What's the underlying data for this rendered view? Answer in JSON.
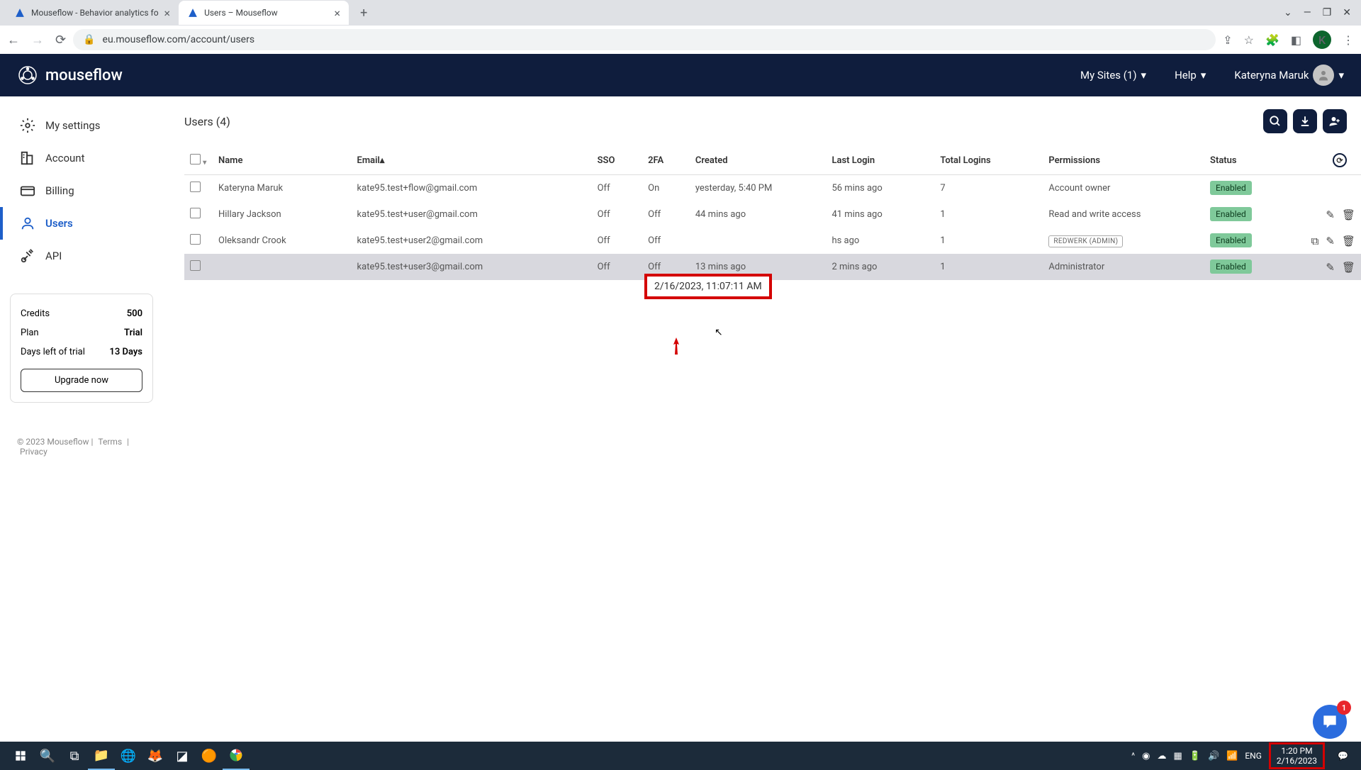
{
  "tabs": [
    {
      "title": "Mouseflow - Behavior analytics fo",
      "active": false
    },
    {
      "title": "Users – Mouseflow",
      "active": true
    }
  ],
  "url": "eu.mouseflow.com/account/users",
  "profile_initial": "K",
  "brand": "mouseflow",
  "header": {
    "my_sites": "My Sites (1)",
    "help": "Help",
    "user_name": "Kateryna Maruk"
  },
  "sidebar": {
    "items": [
      {
        "label": "My settings",
        "icon": "gear"
      },
      {
        "label": "Account",
        "icon": "building"
      },
      {
        "label": "Billing",
        "icon": "card"
      },
      {
        "label": "Users",
        "icon": "person",
        "active": true
      },
      {
        "label": "API",
        "icon": "plug"
      }
    ]
  },
  "credits": {
    "credits_label": "Credits",
    "credits_value": "500",
    "plan_label": "Plan",
    "plan_value": "Trial",
    "days_label": "Days left of trial",
    "days_value": "13 Days",
    "upgrade": "Upgrade now"
  },
  "footer": {
    "copyright": "© 2023 Mouseflow",
    "terms": "Terms",
    "privacy": "Privacy"
  },
  "page_title": "Users (4)",
  "table": {
    "headers": {
      "name": "Name",
      "email": "Email",
      "sso": "SSO",
      "twofa": "2FA",
      "created": "Created",
      "last_login": "Last Login",
      "total_logins": "Total Logins",
      "permissions": "Permissions",
      "status": "Status"
    },
    "rows": [
      {
        "name": "Kateryna Maruk",
        "email": "kate95.test+flow@gmail.com",
        "sso": "Off",
        "twofa": "On",
        "created": "yesterday, 5:40 PM",
        "last_login": "56 mins ago",
        "total_logins": "7",
        "permissions": "Account owner",
        "status": "Enabled",
        "actions": []
      },
      {
        "name": "Hillary Jackson",
        "email": "kate95.test+user@gmail.com",
        "sso": "Off",
        "twofa": "Off",
        "created": "44 mins ago",
        "last_login": "41 mins ago",
        "total_logins": "1",
        "permissions": "Read and write access",
        "status": "Enabled",
        "actions": [
          "edit",
          "delete"
        ]
      },
      {
        "name": "Oleksandr Crook",
        "email": "kate95.test+user2@gmail.com",
        "sso": "Off",
        "twofa": "Off",
        "created": "",
        "last_login": "hs ago",
        "total_logins": "1",
        "permissions_badge": "REDWERK (ADMIN)",
        "status": "Enabled",
        "actions": [
          "copy",
          "edit",
          "delete"
        ]
      },
      {
        "name": "",
        "email": "kate95.test+user3@gmail.com",
        "sso": "Off",
        "twofa": "Off",
        "created": "13 mins ago",
        "last_login": "2 mins ago",
        "total_logins": "1",
        "permissions": "Administrator",
        "status": "Enabled",
        "actions": [
          "edit",
          "delete"
        ],
        "hover": true
      }
    ]
  },
  "tooltip": "2/16/2023, 11:07:11 AM",
  "chat_badge": "1",
  "taskbar": {
    "lang": "ENG",
    "time": "1:20 PM",
    "date": "2/16/2023"
  }
}
